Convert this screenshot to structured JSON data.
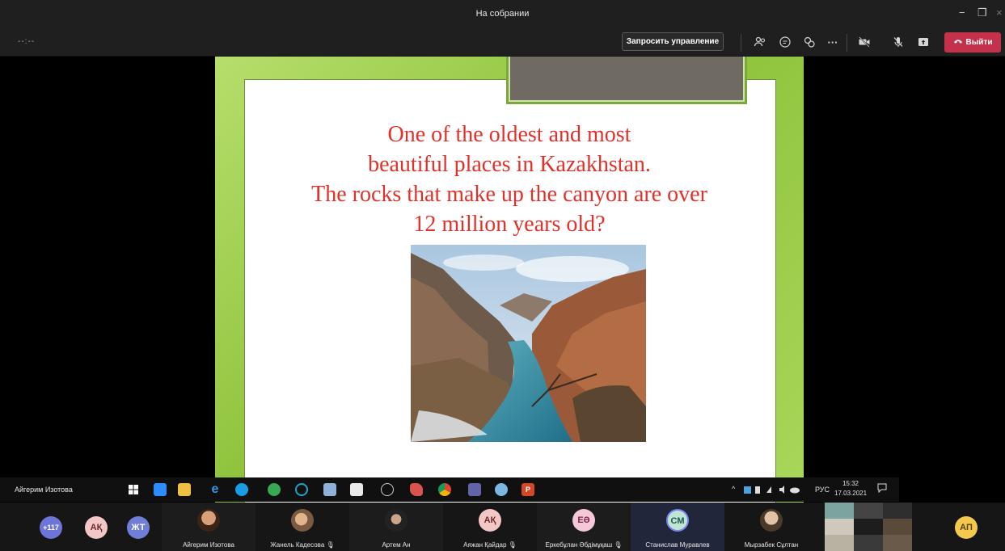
{
  "window": {
    "title": "На собрании",
    "controls": [
      "−",
      "❐",
      "×"
    ]
  },
  "toolbar": {
    "timer": "--:--",
    "request_control_label": "Запросить управление",
    "leave_label": "Выйти",
    "icons": [
      "participants-icon",
      "chat-icon",
      "reactions-icon",
      "more-icon",
      "camera-off-icon",
      "mic-off-icon",
      "share-icon"
    ]
  },
  "slide": {
    "line1": "One of the oldest and most",
    "line2": "beautiful places in Kazakhstan.",
    "line3": "The rocks that make up the canyon are over",
    "line4": "12 million years old?",
    "text_color": "#e4302a",
    "frame_color": "#9fcf4e"
  },
  "presenter": {
    "name": "Айгерим Изотова"
  },
  "tray": {
    "lang": "РУС",
    "time": "15:32",
    "date": "17.03.2021"
  },
  "participants": {
    "overflow": "+117",
    "avatars_left": [
      {
        "initials": "АҚ",
        "bg": "#f4c7c7",
        "fg": "#6b2a2a"
      },
      {
        "initials": "ЖТ",
        "bg": "#6f7fd8",
        "fg": "#ffffff"
      }
    ],
    "tiles": [
      {
        "name": "Айгерим Изотова",
        "muted": false
      },
      {
        "name": "Жанель Кадесова",
        "muted": true
      },
      {
        "name": "Артем Ан",
        "muted": false
      },
      {
        "name": "Аяжан Қайдар",
        "muted": true,
        "initials": "АҚ"
      },
      {
        "name": "Еркебұлан Әбдімұқаш",
        "muted": true,
        "initials": "ЕӘ"
      },
      {
        "name": "Станислав Муравлев",
        "muted": false,
        "initials": "СМ"
      },
      {
        "name": "Мырзабек Сұлтан",
        "muted": false
      }
    ],
    "last_avatar": {
      "initials": "АП",
      "bg": "#f2c94c",
      "fg": "#5a3f00"
    }
  }
}
